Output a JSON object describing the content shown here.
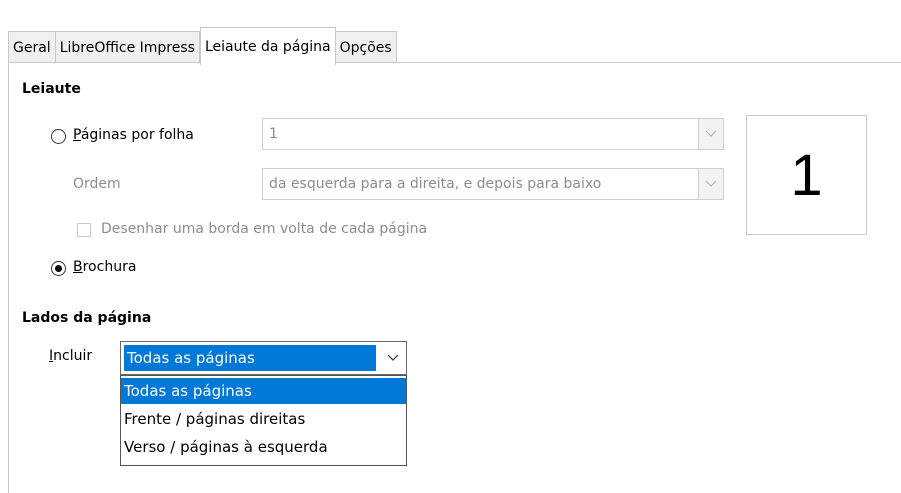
{
  "tabs": [
    {
      "label": "Geral",
      "active": false
    },
    {
      "label": "LibreOffice Impress",
      "active": false
    },
    {
      "label": "Leiaute da página",
      "active": true
    },
    {
      "label": "Opções",
      "active": false
    }
  ],
  "layout": {
    "heading": "Leiaute",
    "pages_per_sheet": {
      "label": "Páginas por folha",
      "selected": false,
      "value": "1"
    },
    "order": {
      "label": "Ordem",
      "value": "da esquerda para a direita, e depois para baixo"
    },
    "draw_border": {
      "label": "Desenhar uma borda em volta de cada página",
      "checked": false
    },
    "brochure": {
      "label": "Brochura",
      "selected": true
    },
    "preview_number": "1"
  },
  "page_sides": {
    "heading": "Lados da página",
    "include_label": "Incluir",
    "include_value": "Todas as páginas",
    "options": [
      "Todas as páginas",
      "Frente / páginas direitas",
      "Verso / páginas à esquerda"
    ],
    "highlighted_index": 0
  },
  "colors": {
    "accent": "#0078d7",
    "disabled_text": "#8c8c8c",
    "border": "#c9c9c9"
  }
}
